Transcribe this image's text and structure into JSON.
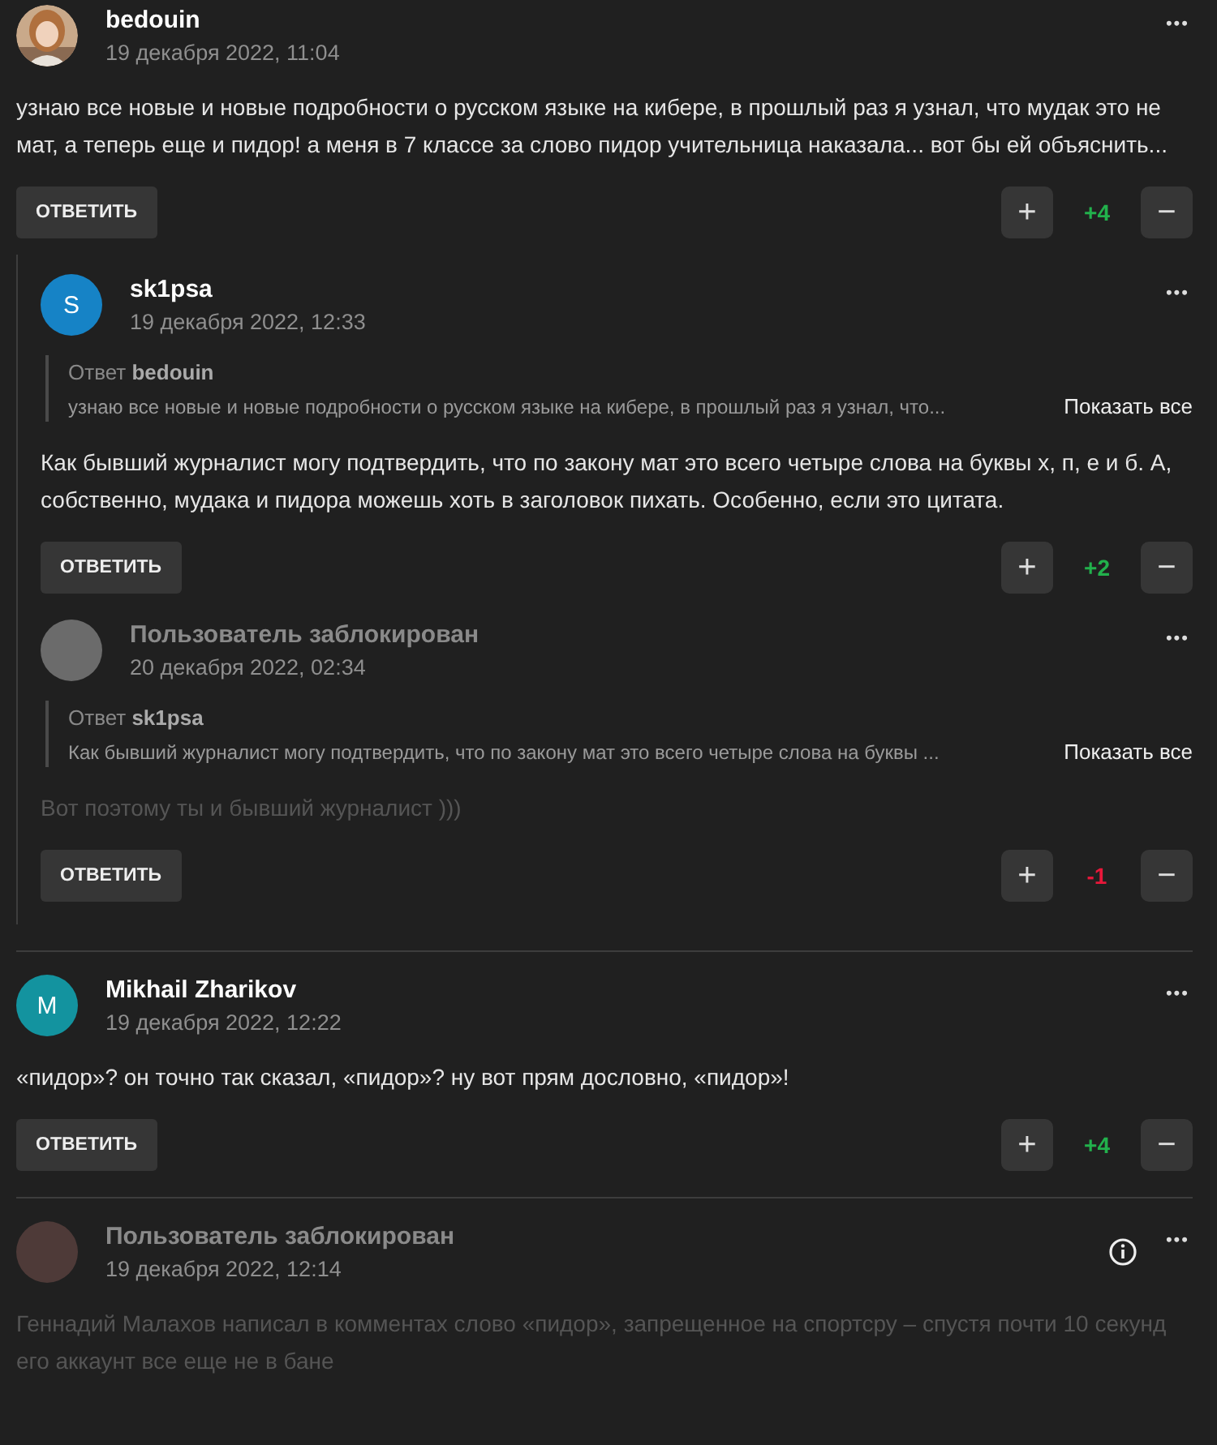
{
  "comments": [
    {
      "author": "bedouin",
      "date": "19 декабря 2022, 11:04",
      "blocked": false,
      "avatar": {
        "kind": "picture"
      },
      "text": "узнаю все новые и новые подробности о русском языке на кибере, в прошлый раз я узнал, что мудак это не мат, а теперь еще и пидор! а меня в 7 классе за слово пидор учительница наказала... вот бы ей объяснить...",
      "reply_button": "ОТВЕТИТЬ",
      "plus": "+",
      "minus": "−",
      "score": {
        "text": "+4",
        "color": "#22b14c"
      },
      "menu": "•••",
      "children": [
        {
          "author": "sk1psa",
          "date": "19 декабря 2022, 12:33",
          "blocked": false,
          "avatar": {
            "kind": "letter",
            "letter": "S",
            "color": "#1683c6"
          },
          "quote": {
            "label": "Ответ",
            "author": "bedouin",
            "text": "узнаю все новые и новые подробности о русском языке на кибере, в прошлый раз я узнал, что...",
            "more": "Показать все"
          },
          "text": "Как бывший журналист могу подтвердить, что по закону мат это всего четыре слова на буквы х, п, е и б. А, собственно, мудака и пидора можешь хоть в заголовок пихать. Особенно, если это цитата.",
          "reply_button": "ОТВЕТИТЬ",
          "plus": "+",
          "minus": "−",
          "score": {
            "text": "+2",
            "color": "#22b14c"
          },
          "menu": "•••"
        },
        {
          "author": "Пользователь заблокирован",
          "date": "20 декабря 2022, 02:34",
          "blocked": true,
          "avatar": {
            "kind": "blank",
            "color": "#6b6b6b"
          },
          "quote": {
            "label": "Ответ",
            "author": "sk1psa",
            "text": "Как бывший журналист могу подтвердить, что по закону мат это всего четыре слова на буквы ...",
            "more": "Показать все"
          },
          "text": "Вот поэтому ты и бывший журналист )))",
          "reply_button": "ОТВЕТИТЬ",
          "plus": "+",
          "minus": "−",
          "score": {
            "text": "-1",
            "color": "#e8173a"
          },
          "menu": "•••"
        }
      ]
    },
    {
      "author": "Mikhail Zharikov",
      "date": "19 декабря 2022, 12:22",
      "blocked": false,
      "avatar": {
        "kind": "letter",
        "letter": "M",
        "color": "#13939f"
      },
      "text": "«пидор»? он точно так сказал, «пидор»? ну вот прям дословно, «пидор»!",
      "reply_button": "ОТВЕТИТЬ",
      "plus": "+",
      "minus": "−",
      "score": {
        "text": "+4",
        "color": "#22b14c"
      },
      "menu": "•••"
    },
    {
      "author": "Пользователь заблокирован",
      "date": "19 декабря 2022, 12:14",
      "blocked": true,
      "info": true,
      "avatar": {
        "kind": "blank",
        "color": "#4e3a38"
      },
      "text": "Геннадий Малахов написал в комментах слово «пидор», запрещенное на спортсру – спустя почти 10 секунд его аккаунт все еще не в бане",
      "menu": "•••"
    }
  ]
}
